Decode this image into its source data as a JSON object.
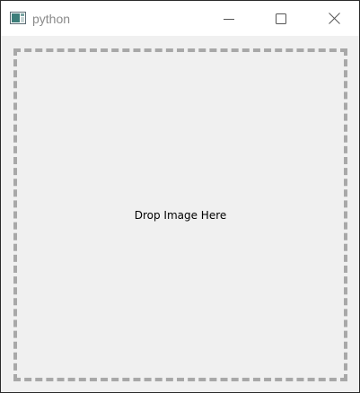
{
  "window": {
    "title": "python",
    "icons": {
      "app": "app-window-icon",
      "minimize": "minimize-icon",
      "maximize": "maximize-icon",
      "close": "close-icon"
    }
  },
  "drop_zone": {
    "label": "Drop Image Here"
  },
  "colors": {
    "titlebar_bg": "#ffffff",
    "title_text": "#8a8a8a",
    "content_bg": "#f0f0f0",
    "dashed_border": "#a8a8a8",
    "label_text": "#000000"
  }
}
